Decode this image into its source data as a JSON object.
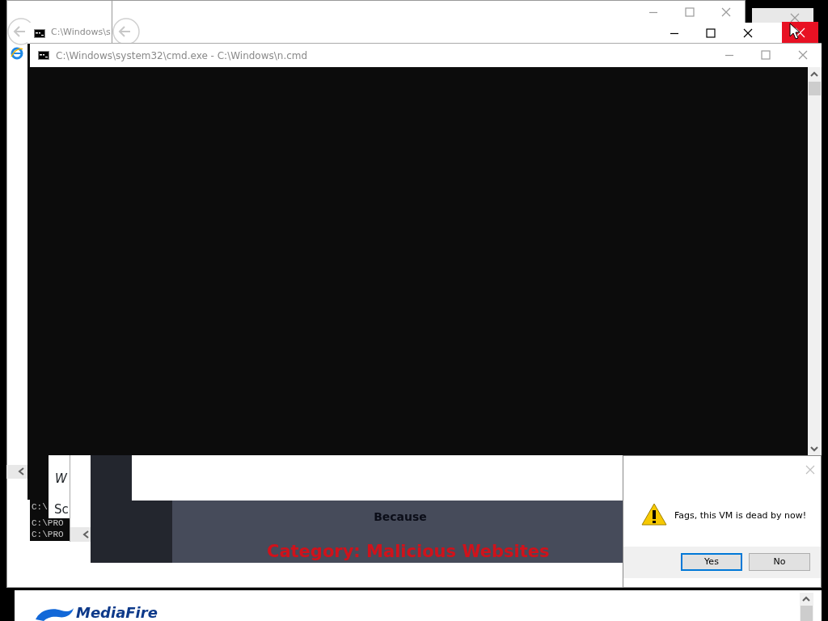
{
  "cmd_windows": [
    {
      "title": "C:\\Windows\\s"
    },
    {
      "title": "C:\\Windows\\system32\\cmd.exe - C:\\Windows\\n.cmd"
    }
  ],
  "console_lines": [
    "C:\\",
    "C:\\PRO",
    "C:\\PRO"
  ],
  "page_fragments": [
    "W",
    "Sc"
  ],
  "blocked_page": {
    "heading": "Because",
    "category": "Category: Malicious Websites"
  },
  "message_box": {
    "text": "Fags, this VM is dead by now!",
    "buttons": [
      {
        "label": "Yes",
        "selected": true
      },
      {
        "label": "No",
        "selected": false
      }
    ]
  },
  "logo": "MediaFire"
}
